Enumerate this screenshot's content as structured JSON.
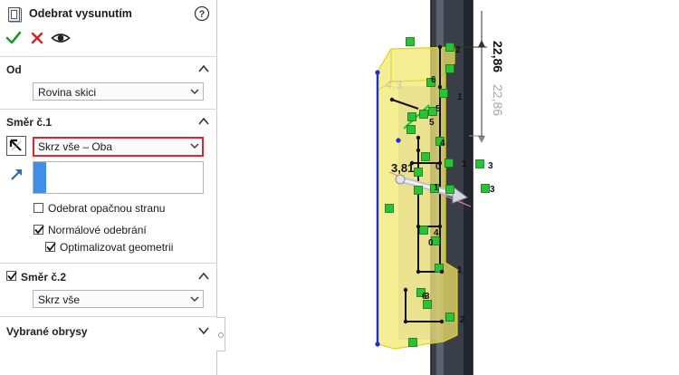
{
  "panel": {
    "title": "Odebrat vysunutím",
    "actions": {
      "ok_icon": "check-icon",
      "cancel_icon": "close-icon",
      "preview_icon": "eye-icon"
    },
    "from": {
      "label": "Od",
      "value": "Rovina skici"
    },
    "direction1": {
      "label": "Směr č.1",
      "value": "Skrz vše – Oba",
      "flip_side_label": "Odebrat opačnou stranu",
      "flip_side_checked": false,
      "normal_cut_label": "Normálové odebrání",
      "normal_cut_checked": true,
      "optimize_label": "Optimalizovat geometrii",
      "optimize_checked": true
    },
    "direction2": {
      "label": "Směr č.2",
      "checked": true,
      "value": "Skrz vše"
    },
    "selected_contours": {
      "label": "Vybrané obrysy"
    }
  },
  "viewport": {
    "dimension_primary": "22,86",
    "dimension_preview": "22,86",
    "dimension_small": "3,81",
    "faded_text": "4.3",
    "relation_labels": [
      "2",
      "6",
      "1",
      "5",
      "5",
      "4",
      "1",
      "0",
      "3",
      "1",
      "3",
      "4",
      "0",
      "6",
      "1",
      "3",
      "2"
    ],
    "colors": {
      "relation_marker": "#27c436",
      "preview_fill": "#f3e86a",
      "sketch_line": "#111111",
      "selected_edge": "#1a2fd6",
      "profile": "#262b33"
    }
  }
}
